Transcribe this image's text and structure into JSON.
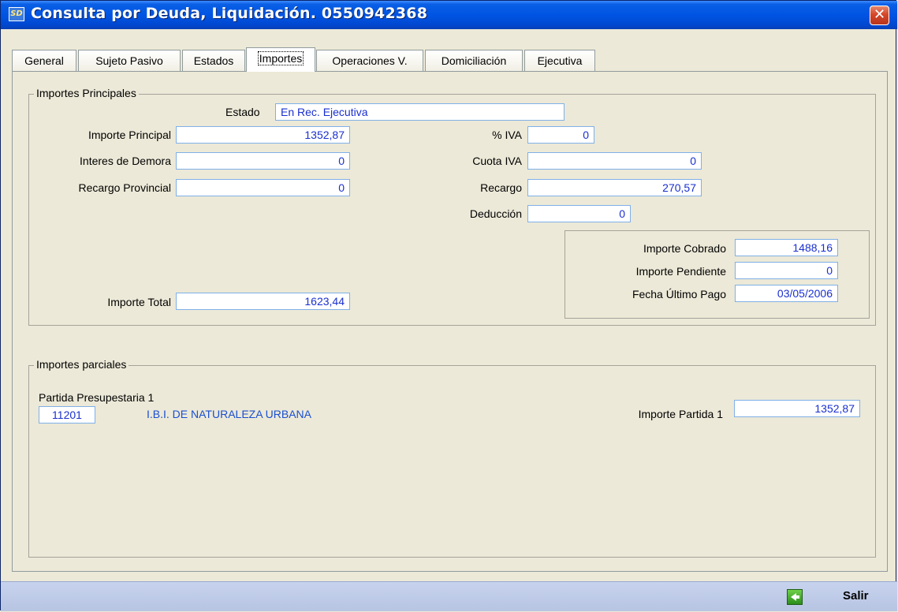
{
  "window": {
    "title": "Consulta por Deuda, Liquidación. 0550942368",
    "close_glyph": "✕",
    "app_icon_text": "SD"
  },
  "tabs": [
    {
      "label": "General"
    },
    {
      "label": "Sujeto Pasivo"
    },
    {
      "label": "Estados"
    },
    {
      "label": "Importes",
      "active": true
    },
    {
      "label": "Operaciones V."
    },
    {
      "label": "Domiciliación"
    },
    {
      "label": "Ejecutiva"
    }
  ],
  "principales": {
    "title": "Importes Principales",
    "estado": {
      "label": "Estado",
      "value": "En Rec. Ejecutiva"
    },
    "importe_principal": {
      "label": "Importe Principal",
      "value": "1352,87"
    },
    "interes_demora": {
      "label": "Interes de Demora",
      "value": "0"
    },
    "recargo_provincial": {
      "label": "Recargo Provincial",
      "value": "0"
    },
    "pct_iva": {
      "label": "% IVA",
      "value": "0"
    },
    "cuota_iva": {
      "label": "Cuota IVA",
      "value": "0"
    },
    "recargo": {
      "label": "Recargo",
      "value": "270,57"
    },
    "deduccion": {
      "label": "Deducción",
      "value": "0"
    },
    "importe_total": {
      "label": "Importe Total",
      "value": "1623,44"
    },
    "importe_cobrado": {
      "label": "Importe Cobrado",
      "value": "1488,16"
    },
    "importe_pendiente": {
      "label": "Importe Pendiente",
      "value": "0"
    },
    "fecha_ultimo_pago": {
      "label": "Fecha Último Pago",
      "value": "03/05/2006"
    }
  },
  "parciales": {
    "title": "Importes parciales",
    "partida_label": "Partida Presupestaria 1",
    "partida_code": "11201",
    "partida_desc": "I.B.I. DE NATURALEZA URBANA",
    "importe_partida": {
      "label": "Importe Partida 1",
      "value": "1352,87"
    }
  },
  "footer": {
    "exit_label": "Salir"
  },
  "colors": {
    "field_text": "#1a2fd0",
    "field_border": "#7fb0e8",
    "titlebar": "#0054e3"
  }
}
